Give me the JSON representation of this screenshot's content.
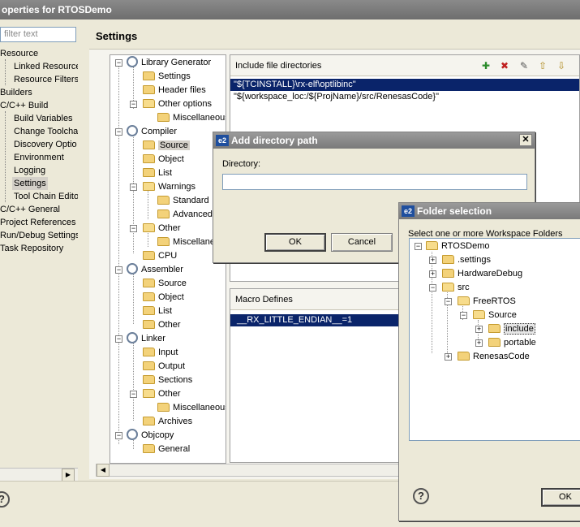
{
  "window": {
    "title": "operties for RTOSDemo"
  },
  "filter": {
    "placeholder": "filter text"
  },
  "left_tree": {
    "items": [
      {
        "label": "Resource"
      },
      {
        "label": "Linked Resource"
      },
      {
        "label": "Resource Filters"
      },
      {
        "label": "Builders"
      },
      {
        "label": "C/C++ Build"
      },
      {
        "label": "Build Variables"
      },
      {
        "label": "Change Toolcha"
      },
      {
        "label": "Discovery Optio"
      },
      {
        "label": "Environment"
      },
      {
        "label": "Logging"
      },
      {
        "label": "Settings"
      },
      {
        "label": "Tool Chain Edito"
      },
      {
        "label": "C/C++ General"
      },
      {
        "label": "Project References"
      },
      {
        "label": "Run/Debug Settings"
      },
      {
        "label": "Task Repository"
      }
    ]
  },
  "page": {
    "title": "Settings"
  },
  "tool_tree": {
    "items": [
      {
        "label": "Library Generator"
      },
      {
        "label": "Settings"
      },
      {
        "label": "Header files"
      },
      {
        "label": "Other options"
      },
      {
        "label": "Miscellaneous"
      },
      {
        "label": "Compiler"
      },
      {
        "label": "Source"
      },
      {
        "label": "Object"
      },
      {
        "label": "List"
      },
      {
        "label": "Warnings"
      },
      {
        "label": "Standard"
      },
      {
        "label": "Advanced"
      },
      {
        "label": "Other"
      },
      {
        "label": "Miscellane"
      },
      {
        "label": "CPU"
      },
      {
        "label": "Assembler"
      },
      {
        "label": "Source"
      },
      {
        "label": "Object"
      },
      {
        "label": "List"
      },
      {
        "label": "Other"
      },
      {
        "label": "Linker"
      },
      {
        "label": "Input"
      },
      {
        "label": "Output"
      },
      {
        "label": "Sections"
      },
      {
        "label": "Other"
      },
      {
        "label": "Miscellaneous"
      },
      {
        "label": "Archives"
      },
      {
        "label": "Objcopy"
      },
      {
        "label": "General"
      }
    ]
  },
  "include_panel": {
    "title": "Include file directories",
    "rows": [
      "\"${TCINSTALL}\\rx-elf\\optlibinc\"",
      "\"${workspace_loc:/${ProjName}/src/RenesasCode}\""
    ]
  },
  "macro_panel": {
    "title": "Macro Defines",
    "rows": [
      "__RX_LITTLE_ENDIAN__=1"
    ]
  },
  "add_dir_dialog": {
    "icon": "e2",
    "title": "Add directory path",
    "directory_label": "Directory:",
    "directory_value": "",
    "ok_label": "OK",
    "cancel_label": "Cancel"
  },
  "folder_dialog": {
    "icon": "e2",
    "title": "Folder selection",
    "prompt": "Select one or more Workspace Folders",
    "tree": [
      {
        "label": "RTOSDemo"
      },
      {
        "label": ".settings"
      },
      {
        "label": "HardwareDebug"
      },
      {
        "label": "src"
      },
      {
        "label": "FreeRTOS"
      },
      {
        "label": "Source"
      },
      {
        "label": "include"
      },
      {
        "label": "portable"
      },
      {
        "label": "RenesasCode"
      }
    ],
    "ok_label": "OK"
  },
  "colors": {
    "selection": "#0a246a",
    "dialog_bg": "#ece9d8",
    "title_bar": "#7a7a7a"
  }
}
